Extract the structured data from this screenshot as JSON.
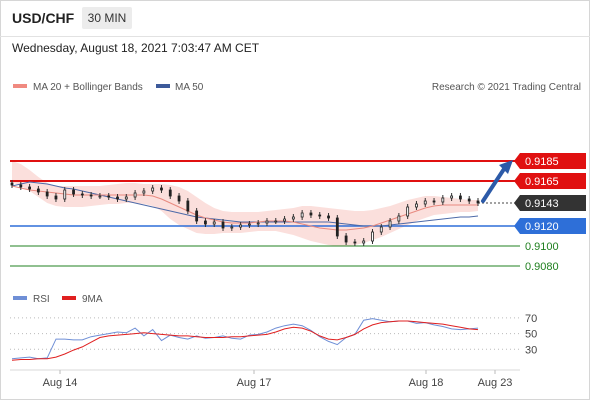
{
  "header": {
    "symbol": "USD/CHF",
    "timeframe": "30 MIN",
    "datetime": "Wednesday, August 18, 2021 7:03:47 AM CET"
  },
  "legend": {
    "ma20": {
      "label": "MA 20 + Bollinger Bands",
      "color": "#f08a80"
    },
    "ma50": {
      "label": "MA 50",
      "color": "#3d5a9a"
    },
    "rsi": {
      "label": "RSI",
      "color": "#6f8fd6"
    },
    "ma9": {
      "label": "9MA",
      "color": "#e02020"
    }
  },
  "credit": "Research © 2021 Trading Central",
  "chart_data": [
    {
      "type": "line",
      "title": "",
      "x_labels": [
        "Aug 14",
        "Aug 17",
        "Aug 18",
        "Aug 23"
      ],
      "ylim": [
        0.9075,
        0.9195
      ],
      "last_price": 0.9143,
      "levels": [
        {
          "value": 0.9185,
          "label": "0.9185",
          "kind": "resistance",
          "color": "#e01010"
        },
        {
          "value": 0.9165,
          "label": "0.9165",
          "kind": "resistance",
          "color": "#e01010"
        },
        {
          "value": 0.9143,
          "label": "0.9143",
          "kind": "last",
          "color": "#333333"
        },
        {
          "value": 0.912,
          "label": "0.9120",
          "kind": "pivot",
          "color": "#2e6fd8"
        },
        {
          "value": 0.91,
          "label": "0.9100",
          "kind": "support",
          "color": "#208020"
        },
        {
          "value": 0.908,
          "label": "0.9080",
          "kind": "support",
          "color": "#208020"
        }
      ],
      "price": [
        0.9161,
        0.9159,
        0.9157,
        0.9154,
        0.915,
        0.9147,
        0.9156,
        0.9152,
        0.9151,
        0.915,
        0.915,
        0.9149,
        0.9147,
        0.9149,
        0.9153,
        0.9155,
        0.9158,
        0.9156,
        0.915,
        0.9145,
        0.9135,
        0.9125,
        0.9122,
        0.9124,
        0.9118,
        0.9119,
        0.9121,
        0.9122,
        0.9123,
        0.9125,
        0.9125,
        0.9127,
        0.9129,
        0.9133,
        0.9131,
        0.913,
        0.9128,
        0.911,
        0.9104,
        0.9103,
        0.9105,
        0.9114,
        0.9119,
        0.9125,
        0.913,
        0.9139,
        0.9142,
        0.9145,
        0.9144,
        0.9148,
        0.915,
        0.9147,
        0.9145,
        0.9143
      ],
      "ma50": [
        0.916,
        0.9162,
        0.9164,
        0.9163,
        0.9162,
        0.916,
        0.9158,
        0.9157,
        0.9155,
        0.9153,
        0.9151,
        0.9149,
        0.9147,
        0.9145,
        0.9143,
        0.9141,
        0.9139,
        0.9137,
        0.9135,
        0.9133,
        0.9131,
        0.9129,
        0.9128,
        0.9127,
        0.9126,
        0.9125,
        0.9124,
        0.9124,
        0.9124,
        0.9124,
        0.9124,
        0.9124,
        0.9124,
        0.9124,
        0.9124,
        0.9124,
        0.9124,
        0.9123,
        0.9122,
        0.9121,
        0.912,
        0.912,
        0.912,
        0.9121,
        0.9122,
        0.9123,
        0.9124,
        0.9125,
        0.9126,
        0.9127,
        0.9128,
        0.9129,
        0.9129,
        0.913
      ],
      "ma20": [
        0.916,
        0.9158,
        0.9156,
        0.9155,
        0.9154,
        0.9153,
        0.9152,
        0.9151,
        0.9151,
        0.9151,
        0.9151,
        0.9151,
        0.9151,
        0.9151,
        0.9151,
        0.9151,
        0.915,
        0.9147,
        0.9143,
        0.9139,
        0.9135,
        0.9131,
        0.9128,
        0.9126,
        0.9124,
        0.9123,
        0.9123,
        0.9123,
        0.9124,
        0.9125,
        0.9125,
        0.9125,
        0.9124,
        0.9122,
        0.912,
        0.9118,
        0.9117,
        0.9116,
        0.9116,
        0.9117,
        0.9118,
        0.912,
        0.9123,
        0.9126,
        0.9129,
        0.9132,
        0.9135,
        0.9138,
        0.914,
        0.9141,
        0.9141,
        0.9141,
        0.9141,
        0.9141
      ],
      "bb_upper": [
        0.9185,
        0.9182,
        0.9176,
        0.9169,
        0.9163,
        0.916,
        0.916,
        0.916,
        0.916,
        0.916,
        0.916,
        0.9161,
        0.9162,
        0.9163,
        0.9163,
        0.9162,
        0.9162,
        0.9162,
        0.9161,
        0.9159,
        0.9155,
        0.9149,
        0.9143,
        0.9138,
        0.9135,
        0.9134,
        0.9134,
        0.9134,
        0.9134,
        0.9135,
        0.9136,
        0.9137,
        0.9138,
        0.914,
        0.914,
        0.9139,
        0.9138,
        0.9137,
        0.9136,
        0.9135,
        0.9135,
        0.9136,
        0.9138,
        0.914,
        0.9143,
        0.9146,
        0.9148,
        0.915,
        0.915,
        0.9149,
        0.9148,
        0.9147,
        0.9146,
        0.9146
      ],
      "bb_lower": [
        0.9164,
        0.916,
        0.9155,
        0.9149,
        0.9143,
        0.914,
        0.9139,
        0.9139,
        0.9139,
        0.914,
        0.9141,
        0.9142,
        0.9142,
        0.9143,
        0.9143,
        0.9142,
        0.914,
        0.9135,
        0.9127,
        0.9121,
        0.9117,
        0.9113,
        0.9112,
        0.9112,
        0.9113,
        0.9113,
        0.9113,
        0.9114,
        0.9115,
        0.9115,
        0.9115,
        0.9113,
        0.9111,
        0.9108,
        0.9105,
        0.9103,
        0.9101,
        0.91,
        0.91,
        0.9101,
        0.9103,
        0.9106,
        0.9109,
        0.9113,
        0.9117,
        0.9121,
        0.9125,
        0.9128,
        0.9131,
        0.9132,
        0.9133,
        0.9134,
        0.9134,
        0.9135
      ],
      "projection": {
        "from": 0.9143,
        "to": 0.918
      }
    },
    {
      "type": "line",
      "title": "",
      "ylim": [
        10,
        80
      ],
      "y_ticks": [
        70,
        50,
        30
      ],
      "series": [
        {
          "name": "RSI",
          "values": [
            18,
            19,
            20,
            18,
            19,
            43,
            43,
            42,
            42,
            46,
            48,
            50,
            52,
            51,
            57,
            47,
            55,
            41,
            48,
            45,
            43,
            47,
            44,
            45,
            47,
            44,
            43,
            48,
            49,
            52,
            57,
            60,
            62,
            60,
            54,
            46,
            40,
            36,
            45,
            49,
            67,
            69,
            67,
            65,
            66,
            66,
            63,
            64,
            61,
            59,
            56,
            55,
            56,
            57
          ]
        },
        {
          "name": "9MA",
          "values": [
            16,
            17,
            17,
            18,
            18,
            20,
            24,
            29,
            33,
            39,
            45,
            47,
            48,
            49,
            50,
            51,
            50,
            49,
            48,
            47,
            47,
            46,
            45,
            45,
            45,
            46,
            46,
            47,
            48,
            49,
            52,
            56,
            58,
            57,
            53,
            47,
            43,
            42,
            45,
            49,
            56,
            61,
            64,
            65,
            66,
            66,
            65,
            64,
            63,
            62,
            60,
            58,
            56,
            55
          ]
        }
      ]
    }
  ]
}
